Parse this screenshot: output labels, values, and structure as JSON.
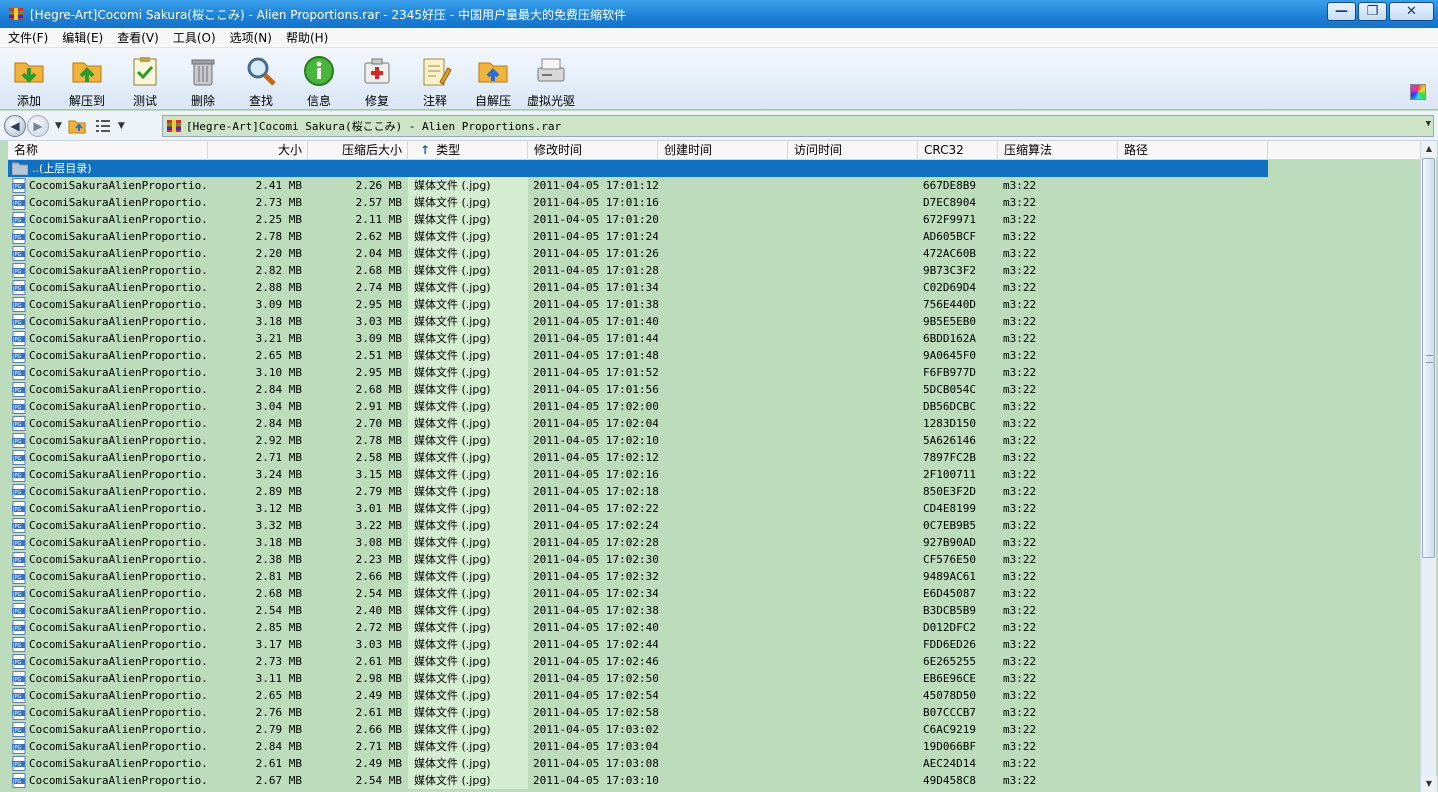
{
  "window": {
    "title": "[Hegre-Art]Cocomi Sakura(桜ここみ) - Alien Proportions.rar - 2345好压 - 中国用户量最大的免费压缩软件",
    "minimize_label": "—",
    "restore_label": "❐",
    "close_label": "✕"
  },
  "menu": [
    "文件(F)",
    "编辑(E)",
    "查看(V)",
    "工具(O)",
    "选项(N)",
    "帮助(H)"
  ],
  "toolbar": [
    {
      "label": "添加",
      "icon": "add-icon"
    },
    {
      "label": "解压到",
      "icon": "extract-icon"
    },
    {
      "label": "测试",
      "icon": "test-icon"
    },
    {
      "label": "删除",
      "icon": "delete-icon"
    },
    {
      "label": "查找",
      "icon": "find-icon"
    },
    {
      "label": "信息",
      "icon": "info-icon"
    },
    {
      "label": "修复",
      "icon": "repair-icon"
    },
    {
      "label": "注释",
      "icon": "comment-icon"
    },
    {
      "label": "自解压",
      "icon": "sfx-icon"
    },
    {
      "label": "虚拟光驱",
      "icon": "virtual-drive-icon"
    }
  ],
  "address": {
    "path": "[Hegre-Art]Cocomi Sakura(桜ここみ) - Alien Proportions.rar"
  },
  "columns": {
    "name": "名称",
    "size": "大小",
    "packed": "压缩后大小",
    "type": "类型",
    "type_sort": "↑",
    "modified": "修改时间",
    "created": "创建时间",
    "accessed": "访问时间",
    "crc": "CRC32",
    "method": "压缩算法",
    "path": "路径"
  },
  "parent_row": {
    "label": "..(上层目录)"
  },
  "files": [
    {
      "name": "CocomiSakuraAlienProportio...",
      "size": "2.41 MB",
      "packed": "2.26 MB",
      "type": "媒体文件 (.jpg)",
      "modified": "2011-04-05 17:01:12",
      "crc": "667DE8B9",
      "method": "m3:22"
    },
    {
      "name": "CocomiSakuraAlienProportio...",
      "size": "2.73 MB",
      "packed": "2.57 MB",
      "type": "媒体文件 (.jpg)",
      "modified": "2011-04-05 17:01:16",
      "crc": "D7EC8904",
      "method": "m3:22"
    },
    {
      "name": "CocomiSakuraAlienProportio...",
      "size": "2.25 MB",
      "packed": "2.11 MB",
      "type": "媒体文件 (.jpg)",
      "modified": "2011-04-05 17:01:20",
      "crc": "672F9971",
      "method": "m3:22"
    },
    {
      "name": "CocomiSakuraAlienProportio...",
      "size": "2.78 MB",
      "packed": "2.62 MB",
      "type": "媒体文件 (.jpg)",
      "modified": "2011-04-05 17:01:24",
      "crc": "AD605BCF",
      "method": "m3:22"
    },
    {
      "name": "CocomiSakuraAlienProportio...",
      "size": "2.20 MB",
      "packed": "2.04 MB",
      "type": "媒体文件 (.jpg)",
      "modified": "2011-04-05 17:01:26",
      "crc": "472AC60B",
      "method": "m3:22"
    },
    {
      "name": "CocomiSakuraAlienProportio...",
      "size": "2.82 MB",
      "packed": "2.68 MB",
      "type": "媒体文件 (.jpg)",
      "modified": "2011-04-05 17:01:28",
      "crc": "9B73C3F2",
      "method": "m3:22"
    },
    {
      "name": "CocomiSakuraAlienProportio...",
      "size": "2.88 MB",
      "packed": "2.74 MB",
      "type": "媒体文件 (.jpg)",
      "modified": "2011-04-05 17:01:34",
      "crc": "C02D69D4",
      "method": "m3:22"
    },
    {
      "name": "CocomiSakuraAlienProportio...",
      "size": "3.09 MB",
      "packed": "2.95 MB",
      "type": "媒体文件 (.jpg)",
      "modified": "2011-04-05 17:01:38",
      "crc": "756E440D",
      "method": "m3:22"
    },
    {
      "name": "CocomiSakuraAlienProportio...",
      "size": "3.18 MB",
      "packed": "3.03 MB",
      "type": "媒体文件 (.jpg)",
      "modified": "2011-04-05 17:01:40",
      "crc": "9B5E5EB0",
      "method": "m3:22"
    },
    {
      "name": "CocomiSakuraAlienProportio...",
      "size": "3.21 MB",
      "packed": "3.09 MB",
      "type": "媒体文件 (.jpg)",
      "modified": "2011-04-05 17:01:44",
      "crc": "6BDD162A",
      "method": "m3:22"
    },
    {
      "name": "CocomiSakuraAlienProportio...",
      "size": "2.65 MB",
      "packed": "2.51 MB",
      "type": "媒体文件 (.jpg)",
      "modified": "2011-04-05 17:01:48",
      "crc": "9A0645F0",
      "method": "m3:22"
    },
    {
      "name": "CocomiSakuraAlienProportio...",
      "size": "3.10 MB",
      "packed": "2.95 MB",
      "type": "媒体文件 (.jpg)",
      "modified": "2011-04-05 17:01:52",
      "crc": "F6FB977D",
      "method": "m3:22"
    },
    {
      "name": "CocomiSakuraAlienProportio...",
      "size": "2.84 MB",
      "packed": "2.68 MB",
      "type": "媒体文件 (.jpg)",
      "modified": "2011-04-05 17:01:56",
      "crc": "5DCB054C",
      "method": "m3:22"
    },
    {
      "name": "CocomiSakuraAlienProportio...",
      "size": "3.04 MB",
      "packed": "2.91 MB",
      "type": "媒体文件 (.jpg)",
      "modified": "2011-04-05 17:02:00",
      "crc": "DB56DCBC",
      "method": "m3:22"
    },
    {
      "name": "CocomiSakuraAlienProportio...",
      "size": "2.84 MB",
      "packed": "2.70 MB",
      "type": "媒体文件 (.jpg)",
      "modified": "2011-04-05 17:02:04",
      "crc": "1283D150",
      "method": "m3:22"
    },
    {
      "name": "CocomiSakuraAlienProportio...",
      "size": "2.92 MB",
      "packed": "2.78 MB",
      "type": "媒体文件 (.jpg)",
      "modified": "2011-04-05 17:02:10",
      "crc": "5A626146",
      "method": "m3:22"
    },
    {
      "name": "CocomiSakuraAlienProportio...",
      "size": "2.71 MB",
      "packed": "2.58 MB",
      "type": "媒体文件 (.jpg)",
      "modified": "2011-04-05 17:02:12",
      "crc": "7897FC2B",
      "method": "m3:22"
    },
    {
      "name": "CocomiSakuraAlienProportio...",
      "size": "3.24 MB",
      "packed": "3.15 MB",
      "type": "媒体文件 (.jpg)",
      "modified": "2011-04-05 17:02:16",
      "crc": "2F100711",
      "method": "m3:22"
    },
    {
      "name": "CocomiSakuraAlienProportio...",
      "size": "2.89 MB",
      "packed": "2.79 MB",
      "type": "媒体文件 (.jpg)",
      "modified": "2011-04-05 17:02:18",
      "crc": "850E3F2D",
      "method": "m3:22"
    },
    {
      "name": "CocomiSakuraAlienProportio...",
      "size": "3.12 MB",
      "packed": "3.01 MB",
      "type": "媒体文件 (.jpg)",
      "modified": "2011-04-05 17:02:22",
      "crc": "CD4E8199",
      "method": "m3:22"
    },
    {
      "name": "CocomiSakuraAlienProportio...",
      "size": "3.32 MB",
      "packed": "3.22 MB",
      "type": "媒体文件 (.jpg)",
      "modified": "2011-04-05 17:02:24",
      "crc": "0C7EB9B5",
      "method": "m3:22"
    },
    {
      "name": "CocomiSakuraAlienProportio...",
      "size": "3.18 MB",
      "packed": "3.08 MB",
      "type": "媒体文件 (.jpg)",
      "modified": "2011-04-05 17:02:28",
      "crc": "927B90AD",
      "method": "m3:22"
    },
    {
      "name": "CocomiSakuraAlienProportio...",
      "size": "2.38 MB",
      "packed": "2.23 MB",
      "type": "媒体文件 (.jpg)",
      "modified": "2011-04-05 17:02:30",
      "crc": "CF576E50",
      "method": "m3:22"
    },
    {
      "name": "CocomiSakuraAlienProportio...",
      "size": "2.81 MB",
      "packed": "2.66 MB",
      "type": "媒体文件 (.jpg)",
      "modified": "2011-04-05 17:02:32",
      "crc": "9489AC61",
      "method": "m3:22"
    },
    {
      "name": "CocomiSakuraAlienProportio...",
      "size": "2.68 MB",
      "packed": "2.54 MB",
      "type": "媒体文件 (.jpg)",
      "modified": "2011-04-05 17:02:34",
      "crc": "E6D45087",
      "method": "m3:22"
    },
    {
      "name": "CocomiSakuraAlienProportio...",
      "size": "2.54 MB",
      "packed": "2.40 MB",
      "type": "媒体文件 (.jpg)",
      "modified": "2011-04-05 17:02:38",
      "crc": "B3DCB5B9",
      "method": "m3:22"
    },
    {
      "name": "CocomiSakuraAlienProportio...",
      "size": "2.85 MB",
      "packed": "2.72 MB",
      "type": "媒体文件 (.jpg)",
      "modified": "2011-04-05 17:02:40",
      "crc": "D012DFC2",
      "method": "m3:22"
    },
    {
      "name": "CocomiSakuraAlienProportio...",
      "size": "3.17 MB",
      "packed": "3.03 MB",
      "type": "媒体文件 (.jpg)",
      "modified": "2011-04-05 17:02:44",
      "crc": "FDD6ED26",
      "method": "m3:22"
    },
    {
      "name": "CocomiSakuraAlienProportio...",
      "size": "2.73 MB",
      "packed": "2.61 MB",
      "type": "媒体文件 (.jpg)",
      "modified": "2011-04-05 17:02:46",
      "crc": "6E265255",
      "method": "m3:22"
    },
    {
      "name": "CocomiSakuraAlienProportio...",
      "size": "3.11 MB",
      "packed": "2.98 MB",
      "type": "媒体文件 (.jpg)",
      "modified": "2011-04-05 17:02:50",
      "crc": "EB6E96CE",
      "method": "m3:22"
    },
    {
      "name": "CocomiSakuraAlienProportio...",
      "size": "2.65 MB",
      "packed": "2.49 MB",
      "type": "媒体文件 (.jpg)",
      "modified": "2011-04-05 17:02:54",
      "crc": "45078D50",
      "method": "m3:22"
    },
    {
      "name": "CocomiSakuraAlienProportio...",
      "size": "2.76 MB",
      "packed": "2.61 MB",
      "type": "媒体文件 (.jpg)",
      "modified": "2011-04-05 17:02:58",
      "crc": "B07CCCB7",
      "method": "m3:22"
    },
    {
      "name": "CocomiSakuraAlienProportio...",
      "size": "2.79 MB",
      "packed": "2.66 MB",
      "type": "媒体文件 (.jpg)",
      "modified": "2011-04-05 17:03:02",
      "crc": "C6AC9219",
      "method": "m3:22"
    },
    {
      "name": "CocomiSakuraAlienProportio...",
      "size": "2.84 MB",
      "packed": "2.71 MB",
      "type": "媒体文件 (.jpg)",
      "modified": "2011-04-05 17:03:04",
      "crc": "19D066BF",
      "method": "m3:22"
    },
    {
      "name": "CocomiSakuraAlienProportio...",
      "size": "2.61 MB",
      "packed": "2.49 MB",
      "type": "媒体文件 (.jpg)",
      "modified": "2011-04-05 17:03:08",
      "crc": "AEC24D14",
      "method": "m3:22"
    },
    {
      "name": "CocomiSakuraAlienProportio...",
      "size": "2.67 MB",
      "packed": "2.54 MB",
      "type": "媒体文件 (.jpg)",
      "modified": "2011-04-05 17:03:10",
      "crc": "49D458C8",
      "method": "m3:22"
    }
  ]
}
